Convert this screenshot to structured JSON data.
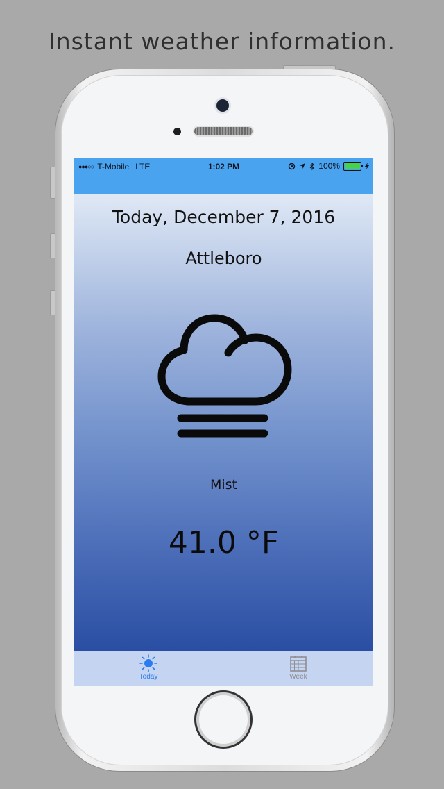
{
  "promo": {
    "caption": "Instant weather information."
  },
  "status_bar": {
    "signal": "●●●○○",
    "carrier": "T-Mobile",
    "network": "LTE",
    "time": "1:02 PM",
    "battery_percent": "100%",
    "battery_level": 1.0
  },
  "weather": {
    "date": "Today, December 7, 2016",
    "city": "Attleboro",
    "icon": "cloud-fog-icon",
    "condition": "Mist",
    "temperature": "41.0 °F"
  },
  "tab_bar": {
    "tabs": [
      {
        "label": "Today",
        "icon": "sun-icon",
        "selected": true
      },
      {
        "label": "Week",
        "icon": "calendar-icon",
        "selected": false
      }
    ]
  },
  "colors": {
    "status_bar": "#4aa3ef",
    "tab_selected": "#2b7cf0",
    "tab_unselected": "#8e8e93",
    "tab_bar_bg": "#c5d4f0",
    "gradient_top": "#dfe8f5",
    "gradient_bottom": "#2a4ea3"
  }
}
